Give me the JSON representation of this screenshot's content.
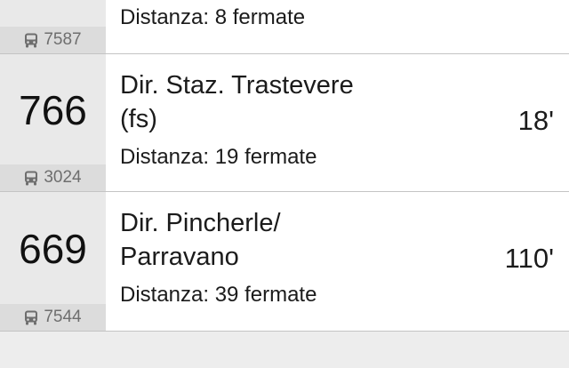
{
  "arrivals": [
    {
      "line": "",
      "stop_code": "7587",
      "destination": [],
      "distance": "Distanza: 8 fermate",
      "eta": ""
    },
    {
      "line": "766",
      "stop_code": "3024",
      "destination": [
        "Dir. Staz. Trastevere",
        "(fs)"
      ],
      "distance": "Distanza: 19 fermate",
      "eta": "18'"
    },
    {
      "line": "669",
      "stop_code": "7544",
      "destination": [
        "Dir. Pincherle/",
        "Parravano"
      ],
      "distance": "Distanza: 39 fermate",
      "eta": "110'"
    }
  ],
  "icons": {
    "stop": "bus-icon"
  },
  "colors": {
    "left_panel": "#e9e9e9",
    "stop_chip": "#dcdcdc",
    "chip_text": "#6e6e6e",
    "divider": "#c4c4c4"
  }
}
